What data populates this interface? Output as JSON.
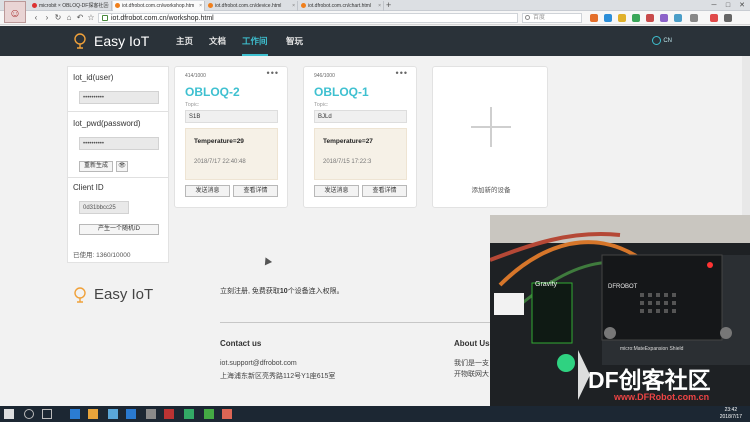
{
  "browser": {
    "tabs": [
      {
        "label": "microbit × OBLOQ-DF探客社区",
        "active": false
      },
      {
        "label": "iot.dfrobot.com.cn/workshop.htm",
        "active": true
      },
      {
        "label": "iot.dfrobot.com.cn/device.html",
        "active": false
      },
      {
        "label": "iot.dfrobot.com.cn/chart.html",
        "active": false
      }
    ],
    "new_tab": "+",
    "url": "iot.dfrobot.com.cn/workshop.html",
    "search_placeholder": "百度",
    "window_controls": [
      "─",
      "□",
      "✕"
    ]
  },
  "site": {
    "logo": "Easy IoT",
    "nav": [
      {
        "label": "主页",
        "active": false
      },
      {
        "label": "文档",
        "active": false
      },
      {
        "label": "工作间",
        "active": true
      },
      {
        "label": "智玩",
        "active": false
      }
    ],
    "lang": "CN"
  },
  "credentials": {
    "iot_id_label": "Iot_id(user)",
    "iot_id_value": "••••••••••",
    "iot_pwd_label": "Iot_pwd(password)",
    "iot_pwd_value": "••••••••••",
    "regen_button": "重新生成",
    "eye": "👁",
    "client_id_label": "Client ID",
    "client_id_value": "0d31bbcc25",
    "random_id_button": "产生一个随机ID",
    "usage": "已使用: 1360/10000"
  },
  "devices": [
    {
      "count": "414/1000",
      "menu": "•••",
      "name": "OBLOQ-2",
      "topic_label": "Topic:",
      "topic": "S1B",
      "message": "Temperature=29",
      "time": "2018/7/17 22:40:48",
      "send_button": "发送消息",
      "view_button": "查看详情"
    },
    {
      "count": "946/1000",
      "menu": "•••",
      "name": "OBLOQ-1",
      "topic_label": "Topic:",
      "topic": "BJLd",
      "message": "Temperature=27",
      "time": "2018/7/15 17:22:3",
      "send_button": "发送消息",
      "view_button": "查看详情"
    }
  ],
  "add_device": "添加新的设备",
  "footer": {
    "logo": "Easy IoT",
    "slogan_a": "立刻注册, 免费获取",
    "slogan_b": "10",
    "slogan_c": "个设备连入权限。",
    "contact_title": "Contact us",
    "email": "iot.support@dfrobot.com",
    "address": "上海浦东新区亮秀路112号Y1座615室",
    "about_title": "About Us",
    "about_line1": "我们是一支",
    "about_line2": "开物联网大"
  },
  "video": {
    "watermark": "DF创客社区",
    "watermark_url": "www.DFRobot.com.cn",
    "board_label": "micro:MateExpansion Shield",
    "brand": "DFROBOT",
    "gravity": "Gravity"
  },
  "taskbar": {
    "time": "23:42",
    "date": "2018/7/17"
  }
}
